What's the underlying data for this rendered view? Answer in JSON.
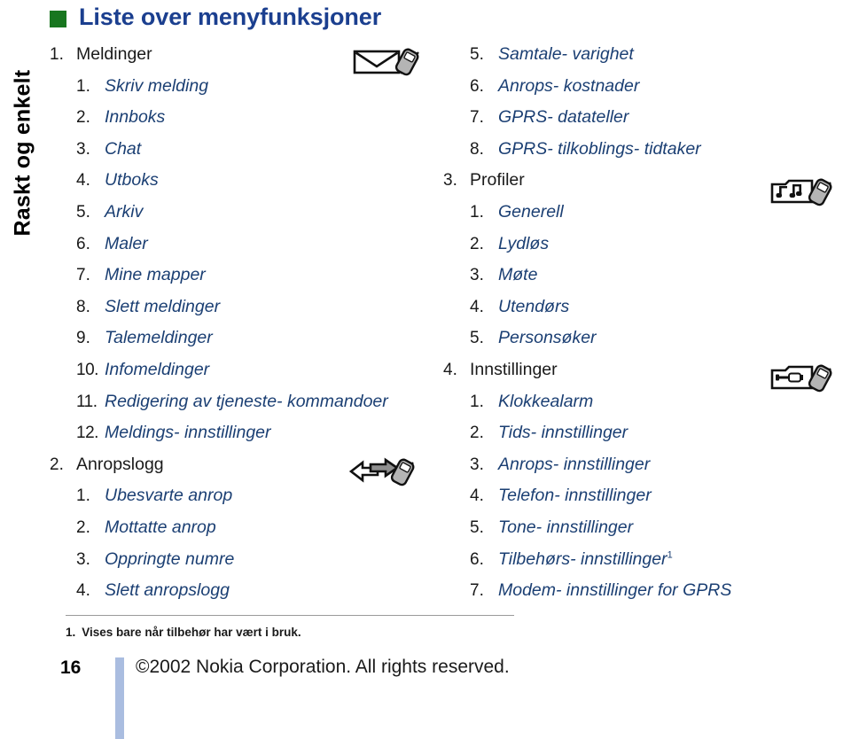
{
  "side_tab": {
    "label": "Raskt og enkelt"
  },
  "heading": {
    "marker_color": "#18761f",
    "title": "Liste over menyfunksjoner",
    "title_color": "#1b3f8f"
  },
  "colors": {
    "level1_text": "#1a1a1a",
    "level2_text": "#1b3f73",
    "green_square": "#18761f",
    "heading_blue": "#1b3f8f",
    "footer_bar": "#aabde0",
    "rule": "#9a9a9a"
  },
  "left_column": {
    "rows": [
      {
        "level": 1,
        "num": "1.",
        "text": "Meldinger"
      },
      {
        "level": 2,
        "num": "1.",
        "text": "Skriv melding"
      },
      {
        "level": 2,
        "num": "2.",
        "text": "Innboks"
      },
      {
        "level": 2,
        "num": "3.",
        "text": "Chat"
      },
      {
        "level": 2,
        "num": "4.",
        "text": "Utboks"
      },
      {
        "level": 2,
        "num": "5.",
        "text": "Arkiv"
      },
      {
        "level": 2,
        "num": "6.",
        "text": "Maler"
      },
      {
        "level": 2,
        "num": "7.",
        "text": "Mine mapper"
      },
      {
        "level": 2,
        "num": "8.",
        "text": "Slett meldinger"
      },
      {
        "level": 2,
        "num": "9.",
        "text": "Talemeldinger"
      },
      {
        "level": 2,
        "num": "10.",
        "text": "Infomeldinger"
      },
      {
        "level": 2,
        "num": "11.",
        "text": "Redigering av tjeneste- kommandoer"
      },
      {
        "level": 2,
        "num": "12.",
        "text": "Meldings- innstillinger"
      },
      {
        "level": 1,
        "num": "2.",
        "text": "Anropslogg"
      },
      {
        "level": 2,
        "num": "1.",
        "text": "Ubesvarte anrop"
      },
      {
        "level": 2,
        "num": "2.",
        "text": "Mottatte anrop"
      },
      {
        "level": 2,
        "num": "3.",
        "text": "Oppringte numre"
      },
      {
        "level": 2,
        "num": "4.",
        "text": "Slett anropslogg"
      }
    ]
  },
  "right_column": {
    "rows": [
      {
        "level": 2,
        "num": "5.",
        "text": "Samtale- varighet"
      },
      {
        "level": 2,
        "num": "6.",
        "text": "Anrops- kostnader"
      },
      {
        "level": 2,
        "num": "7.",
        "text": "GPRS- datateller"
      },
      {
        "level": 2,
        "num": "8.",
        "text": "GPRS- tilkoblings- tidtaker"
      },
      {
        "level": 1,
        "num": "3.",
        "text": "Profiler"
      },
      {
        "level": 2,
        "num": "1.",
        "text": "Generell"
      },
      {
        "level": 2,
        "num": "2.",
        "text": "Lydløs"
      },
      {
        "level": 2,
        "num": "3.",
        "text": "Møte"
      },
      {
        "level": 2,
        "num": "4.",
        "text": "Utendørs"
      },
      {
        "level": 2,
        "num": "5.",
        "text": "Personsøker"
      },
      {
        "level": 1,
        "num": "4.",
        "text": "Innstillinger"
      },
      {
        "level": 2,
        "num": "1.",
        "text": "Klokkealarm"
      },
      {
        "level": 2,
        "num": "2.",
        "text": "Tids- innstillinger"
      },
      {
        "level": 2,
        "num": "3.",
        "text": "Anrops- innstillinger"
      },
      {
        "level": 2,
        "num": "4.",
        "text": "Telefon- innstillinger"
      },
      {
        "level": 2,
        "num": "5.",
        "text": "Tone- innstillinger"
      },
      {
        "level": 2,
        "num": "6.",
        "text": "Tilbehørs- innstillinger",
        "footnote": "1"
      },
      {
        "level": 2,
        "num": "7.",
        "text": "Modem- innstillinger for GPRS"
      }
    ]
  },
  "icons": [
    {
      "name": "messages-envelope-phone-icon",
      "for": "Meldinger"
    },
    {
      "name": "call-log-arrows-phone-icon",
      "for": "Anropslogg"
    },
    {
      "name": "profiles-music-notes-phone-icon",
      "for": "Profiler"
    },
    {
      "name": "settings-screwdriver-phone-icon",
      "for": "Innstillinger"
    }
  ],
  "footnote": {
    "number": "1.",
    "text": "Vises bare når tilbehør har vært i bruk."
  },
  "footer": {
    "page_number": "16",
    "copyright": "©2002 Nokia Corporation. All rights reserved."
  }
}
